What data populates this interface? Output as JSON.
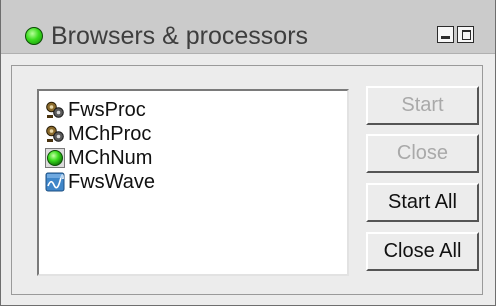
{
  "window": {
    "title": "Browsers & processors"
  },
  "list": {
    "items": [
      {
        "label": "FwsProc",
        "icon": "processor-gears-icon"
      },
      {
        "label": "MChProc",
        "icon": "processor-gears-icon"
      },
      {
        "label": "MChNum",
        "icon": "green-status-icon"
      },
      {
        "label": "FwsWave",
        "icon": "wave-browser-icon"
      }
    ]
  },
  "buttons": {
    "start": {
      "label": "Start",
      "enabled": false
    },
    "close": {
      "label": "Close",
      "enabled": false
    },
    "start_all": {
      "label": "Start All",
      "enabled": true
    },
    "close_all": {
      "label": "Close All",
      "enabled": true
    }
  },
  "colors": {
    "titlebar": "#cbcbcb",
    "window_bg": "#ececec",
    "status_green": "#3bdc1e",
    "disabled_text": "#a9a9a9"
  }
}
